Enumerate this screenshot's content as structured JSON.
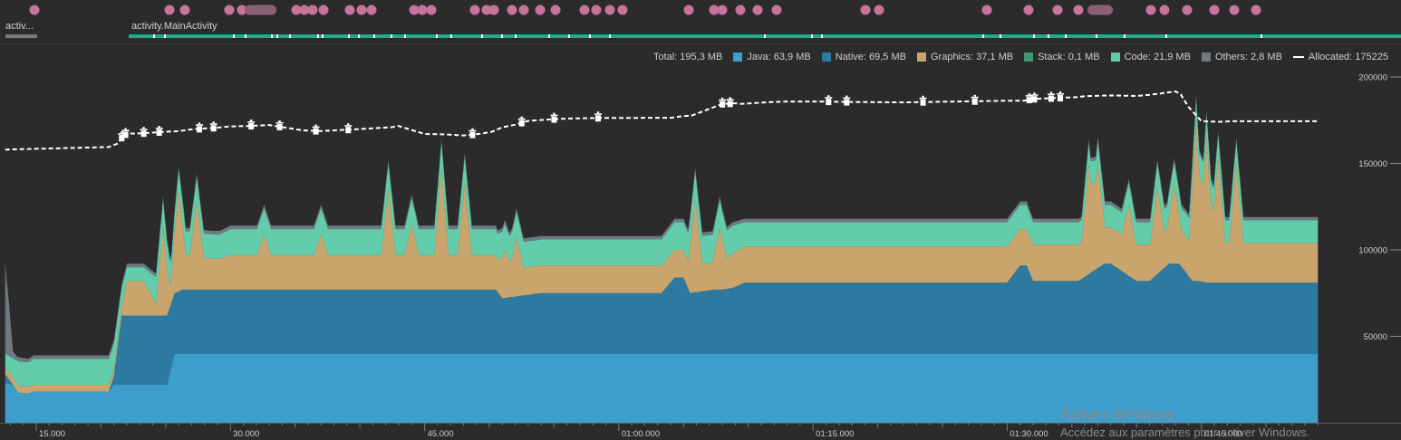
{
  "session": {
    "labels": [
      "activ...",
      "activity.MainActivity"
    ]
  },
  "legend": {
    "total": "Total: 195,3 MB",
    "java": "Java: 63,9 MB",
    "native": "Native: 69,5 MB",
    "graphics": "Graphics: 37,1 MB",
    "stack": "Stack: 0,1 MB",
    "code": "Code: 21,9 MB",
    "others": "Others: 2,8 MB",
    "allocated": "Allocated: 175225"
  },
  "colors": {
    "java": "#3d9ecb",
    "native": "#2d7aa0",
    "graphics": "#c9a46d",
    "stack": "#3f9a73",
    "code": "#62ccab",
    "others": "#6e7a80",
    "allocated": "#ffffff",
    "event_dot": "#c8739a",
    "session_bar": "#22a893"
  },
  "watermark": {
    "title": "Activer Windows",
    "subtitle": "Accédez aux paramètres pour activer Windows."
  },
  "chart_data": {
    "type": "area",
    "stacked": true,
    "xlabel": "",
    "ylabel": "",
    "x_ticks": [
      "15.000",
      "30.000",
      "45.000",
      "01:00.000",
      "01:15.000",
      "01:30.000",
      "01:45.000"
    ],
    "x_tick_seconds": [
      15,
      30,
      45,
      60,
      75,
      90,
      105
    ],
    "y_ticks": [
      "50000",
      "100000",
      "150000",
      "200000"
    ],
    "y_tick_values": [
      50000,
      100000,
      150000,
      200000
    ],
    "ylim": [
      0,
      200000
    ],
    "xlim": [
      12.6,
      114.0
    ],
    "series_order": [
      "java",
      "native",
      "graphics",
      "stack",
      "code",
      "others"
    ],
    "series": [
      {
        "name": "Java",
        "x": [
          12.6,
          13.3,
          13.6,
          14.4,
          14.8,
          20.6,
          21.0,
          21.6,
          25.1,
          25.7,
          114.0
        ],
        "y": [
          23000,
          22000,
          18000,
          17000,
          18000,
          18000,
          22000,
          22000,
          22000,
          40000,
          40000
        ]
      },
      {
        "name": "Native",
        "x": [
          12.6,
          13.3,
          13.6,
          14.4,
          14.8,
          20.6,
          21.0,
          21.6,
          25.1,
          25.7,
          26.3,
          50.5,
          51.0,
          54.0,
          55.0,
          63.3,
          64.3,
          65.0,
          65.5,
          67.4,
          68.0,
          68.8,
          69.7,
          90.0,
          91.0,
          91.5,
          92.0,
          95.5,
          97.5,
          98.0,
          100.0,
          101.0,
          102.5,
          103.3,
          104.3,
          104.7,
          105.5,
          114.0
        ],
        "y": [
          5000,
          -1000,
          -500,
          0,
          0,
          0,
          5000,
          40000,
          40000,
          35000,
          37000,
          37000,
          32000,
          35000,
          35000,
          35000,
          44000,
          44000,
          35000,
          37000,
          37000,
          38000,
          41000,
          41000,
          51000,
          51000,
          42000,
          42000,
          52000,
          52000,
          42000,
          42000,
          52000,
          52000,
          42000,
          42000,
          41000,
          41000
        ]
      },
      {
        "name": "Graphics",
        "x": [
          12.6,
          13.3,
          13.6,
          14.4,
          14.8,
          20.6,
          21.0,
          21.6,
          22.0,
          23.3,
          24.3,
          25.1,
          25.7,
          26.3,
          28.6,
          29.2,
          30.0,
          50.5,
          51.0,
          54.0,
          55.0,
          63.3,
          64.3,
          65.0,
          65.5,
          67.4,
          68.0,
          68.8,
          69.7,
          90.0,
          91.0,
          91.5,
          92.0,
          95.5,
          97.5,
          98.0,
          100.0,
          101.0,
          102.5,
          103.3,
          104.3,
          104.7,
          105.5,
          114.0
        ],
        "y": [
          4000,
          4000,
          4000,
          4000,
          4000,
          4000,
          4000,
          4000,
          20000,
          20000,
          6000,
          6000,
          20000,
          20000,
          18000,
          18000,
          20000,
          20000,
          16000,
          16000,
          16000,
          16000,
          16000,
          16000,
          16000,
          16000,
          16000,
          20000,
          21000,
          21000,
          21000,
          21000,
          21000,
          21000,
          21000,
          21000,
          21000,
          21000,
          21000,
          21000,
          21000,
          21000,
          23000,
          23000
        ]
      },
      {
        "name": "Stack",
        "x": [
          12.6,
          114.0
        ],
        "y": [
          0,
          0
        ]
      },
      {
        "name": "Code",
        "x": [
          12.6,
          13.3,
          13.6,
          14.4,
          14.8,
          20.6,
          21.0,
          21.6,
          22.0,
          23.3,
          24.3,
          25.1,
          25.7,
          26.3,
          28.6,
          29.2,
          30.0,
          63.3,
          64.3,
          65.0,
          65.5,
          67.4,
          68.0,
          68.8,
          69.7,
          75.0,
          76.0,
          90.0,
          91.0,
          91.5,
          92.0,
          95.5,
          97.5,
          98.0,
          100.0,
          101.0,
          102.5,
          103.3,
          104.3,
          104.7,
          105.5,
          114.0
        ],
        "y": [
          8000,
          12000,
          14000,
          14000,
          15000,
          15000,
          15000,
          12000,
          8000,
          8000,
          16000,
          16000,
          10000,
          14000,
          14000,
          14000,
          15000,
          15000,
          16000,
          16000,
          16000,
          16000,
          16000,
          16000,
          14000,
          14000,
          14000,
          14000,
          14000,
          14000,
          13000,
          13000,
          13000,
          13000,
          13000,
          13000,
          13000,
          13000,
          13000,
          13000,
          13000,
          13000
        ]
      },
      {
        "name": "Others",
        "x": [
          12.6,
          12.9,
          13.2,
          13.5,
          14.4,
          114.0
        ],
        "y": [
          52000,
          30000,
          4000,
          2500,
          2000,
          2000
        ]
      }
    ],
    "spikes": [
      {
        "x": 24.8,
        "h": 45000
      },
      {
        "x": 26.0,
        "h": 38000
      },
      {
        "x": 27.4,
        "h": 32000
      },
      {
        "x": 32.6,
        "h": 12000
      },
      {
        "x": 37.0,
        "h": 12000
      },
      {
        "x": 42.2,
        "h": 38000
      },
      {
        "x": 44.0,
        "h": 18000
      },
      {
        "x": 46.3,
        "h": 50000
      },
      {
        "x": 48.1,
        "h": 42000
      },
      {
        "x": 51.2,
        "h": 12000
      },
      {
        "x": 52.1,
        "h": 18000
      },
      {
        "x": 65.9,
        "h": 38000
      },
      {
        "x": 67.8,
        "h": 20000
      },
      {
        "x": 96.3,
        "h": 42000
      },
      {
        "x": 97.0,
        "h": 40000
      },
      {
        "x": 99.4,
        "h": 20000
      },
      {
        "x": 101.6,
        "h": 30000
      },
      {
        "x": 102.9,
        "h": 25000
      },
      {
        "x": 104.6,
        "h": 72000
      },
      {
        "x": 105.4,
        "h": 62000
      },
      {
        "x": 106.3,
        "h": 50000
      },
      {
        "x": 107.7,
        "h": 46000
      }
    ],
    "allocated": {
      "name": "Allocated",
      "x": [
        12.6,
        20.6,
        21.3,
        21.7,
        22.0,
        23.2,
        25.0,
        26.0,
        27.0,
        28.0,
        29.0,
        30.0,
        31.5,
        33.0,
        35.6,
        37.0,
        38.0,
        40.0,
        41.0,
        42.4,
        43.0,
        45.0,
        46.5,
        48.0,
        49.3,
        50.2,
        51.0,
        52.0,
        53.0,
        55.0,
        56.0,
        58.4,
        64.0,
        65.0,
        65.6,
        68.0,
        69.0,
        69.4,
        71.5,
        73.0,
        76.5,
        77.0,
        82.0,
        90.0,
        91.3,
        92.0,
        95.5,
        96.0,
        98.0,
        100.0,
        101.0,
        101.7,
        103.0,
        103.4,
        104.0,
        105.0,
        105.7,
        106.4,
        107.3,
        114.0
      ],
      "y": [
        158000,
        159500,
        161500,
        166000,
        167200,
        167400,
        168300,
        168700,
        169700,
        170200,
        170700,
        171400,
        171700,
        172200,
        169100,
        168700,
        169100,
        169900,
        170300,
        170900,
        171600,
        167000,
        166800,
        166200,
        167100,
        168300,
        170900,
        172400,
        174600,
        175600,
        175900,
        176300,
        176400,
        177400,
        177600,
        184400,
        184800,
        184400,
        185400,
        185800,
        185800,
        185600,
        185300,
        186300,
        186300,
        187300,
        188400,
        188900,
        189300,
        189000,
        189700,
        190300,
        191700,
        190000,
        182700,
        174500,
        174200,
        174100,
        174400,
        174400
      ]
    },
    "gc_markers_x": [
      21.6,
      21.9,
      23.3,
      24.5,
      27.6,
      28.7,
      31.6,
      33.8,
      36.6,
      39.1,
      48.7,
      52.5,
      55.0,
      58.4,
      68.0,
      68.6,
      76.2,
      77.6,
      83.5,
      87.5,
      91.7,
      92.1,
      93.4,
      94.1
    ]
  }
}
